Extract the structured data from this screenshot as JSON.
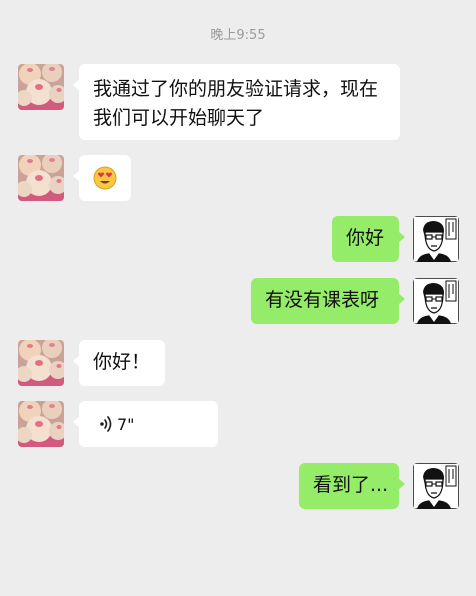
{
  "header": {
    "timestamp": "晚上9:55"
  },
  "messages": [
    {
      "sender": "contact",
      "type": "text",
      "lines": [
        "我通过了你的朋友验证请求，现在",
        "我们可以开始聊天了"
      ]
    },
    {
      "sender": "contact",
      "type": "emoji",
      "emoji": "😍"
    },
    {
      "sender": "me",
      "type": "text",
      "text": "你好"
    },
    {
      "sender": "me",
      "type": "text",
      "text": "有没有课表呀"
    },
    {
      "sender": "contact",
      "type": "text",
      "text": "你好！"
    },
    {
      "sender": "contact",
      "type": "voice",
      "duration": "7\""
    },
    {
      "sender": "me",
      "type": "text",
      "text": "看到了..."
    }
  ],
  "colors": {
    "background": "#ededed",
    "incoming_bubble": "#ffffff",
    "outgoing_bubble": "#95ec69",
    "timestamp": "#9a9a9a"
  },
  "icons": {
    "contact_avatar": "peach-buns-avatar",
    "my_avatar": "manga-character-avatar",
    "voice": "voice-wave-icon"
  }
}
